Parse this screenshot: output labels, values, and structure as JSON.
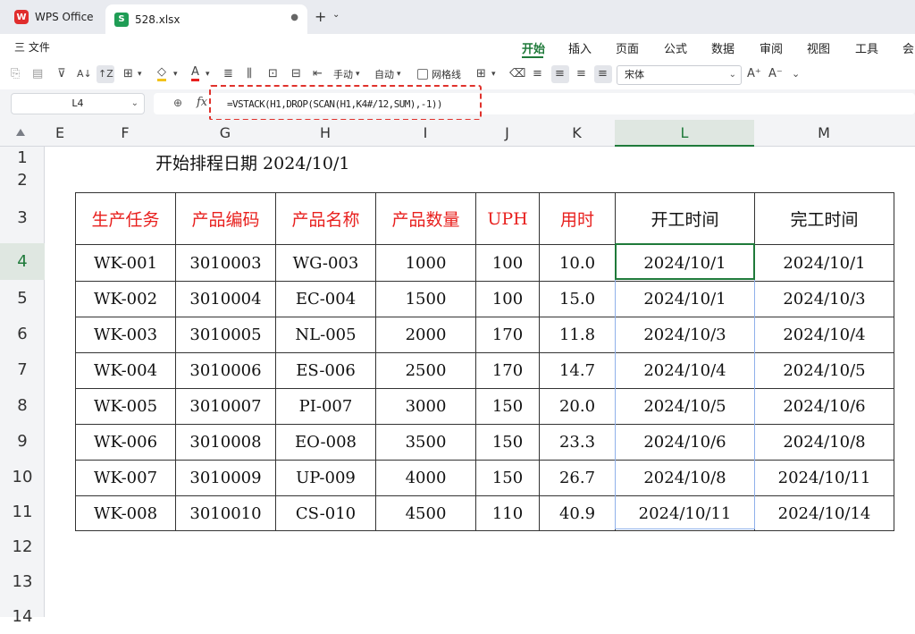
{
  "titlebar": {
    "home_tab": "WPS Office",
    "file_tab": "528.xlsx",
    "wps_logo": "W",
    "sheet_logo": "S"
  },
  "menubar": {
    "file": "三 文件",
    "items": [
      "开始",
      "插入",
      "页面",
      "公式",
      "数据",
      "审阅",
      "视图",
      "工具",
      "会"
    ],
    "active": "开始"
  },
  "toolbar": {
    "wrap_mode": "手动",
    "auto_label": "自动",
    "gridlines_label": "网格线",
    "font_name": "宋体"
  },
  "formula_bar": {
    "cell_ref": "L4",
    "fx_symbol": "fx",
    "formula": "=VSTACK(H1,DROP(SCAN(H1,K4#/12,SUM),-1))"
  },
  "grid": {
    "columns": [
      "E",
      "F",
      "G",
      "H",
      "I",
      "J",
      "K",
      "L",
      "M"
    ],
    "selected_column": "L",
    "rows": [
      "1",
      "2",
      "3",
      "4",
      "5",
      "6",
      "7",
      "8",
      "9",
      "10",
      "11",
      "12",
      "13",
      "14"
    ],
    "selected_row": "4"
  },
  "sheet": {
    "title": "开始排程日期 2024/10/1",
    "headers": [
      "生产任务",
      "产品编码",
      "产品名称",
      "产品数量",
      "UPH",
      "用时",
      "开工时间",
      "完工时间"
    ],
    "rows": [
      [
        "WK-001",
        "3010003",
        "WG-003",
        "1000",
        "100",
        "10.0",
        "2024/10/1",
        "2024/10/1"
      ],
      [
        "WK-002",
        "3010004",
        "EC-004",
        "1500",
        "100",
        "15.0",
        "2024/10/1",
        "2024/10/3"
      ],
      [
        "WK-003",
        "3010005",
        "NL-005",
        "2000",
        "170",
        "11.8",
        "2024/10/3",
        "2024/10/4"
      ],
      [
        "WK-004",
        "3010006",
        "ES-006",
        "2500",
        "170",
        "14.7",
        "2024/10/4",
        "2024/10/5"
      ],
      [
        "WK-005",
        "3010007",
        "PI-007",
        "3000",
        "150",
        "20.0",
        "2024/10/5",
        "2024/10/6"
      ],
      [
        "WK-006",
        "3010008",
        "EO-008",
        "3500",
        "150",
        "23.3",
        "2024/10/6",
        "2024/10/8"
      ],
      [
        "WK-007",
        "3010009",
        "UP-009",
        "4000",
        "150",
        "26.7",
        "2024/10/8",
        "2024/10/11"
      ],
      [
        "WK-008",
        "3010010",
        "CS-010",
        "4500",
        "110",
        "40.9",
        "2024/10/11",
        "2024/10/14"
      ]
    ]
  },
  "colors": {
    "accent": "#1f7a3a",
    "header_red": "#e8201e",
    "highlight_red": "#e0322c"
  }
}
